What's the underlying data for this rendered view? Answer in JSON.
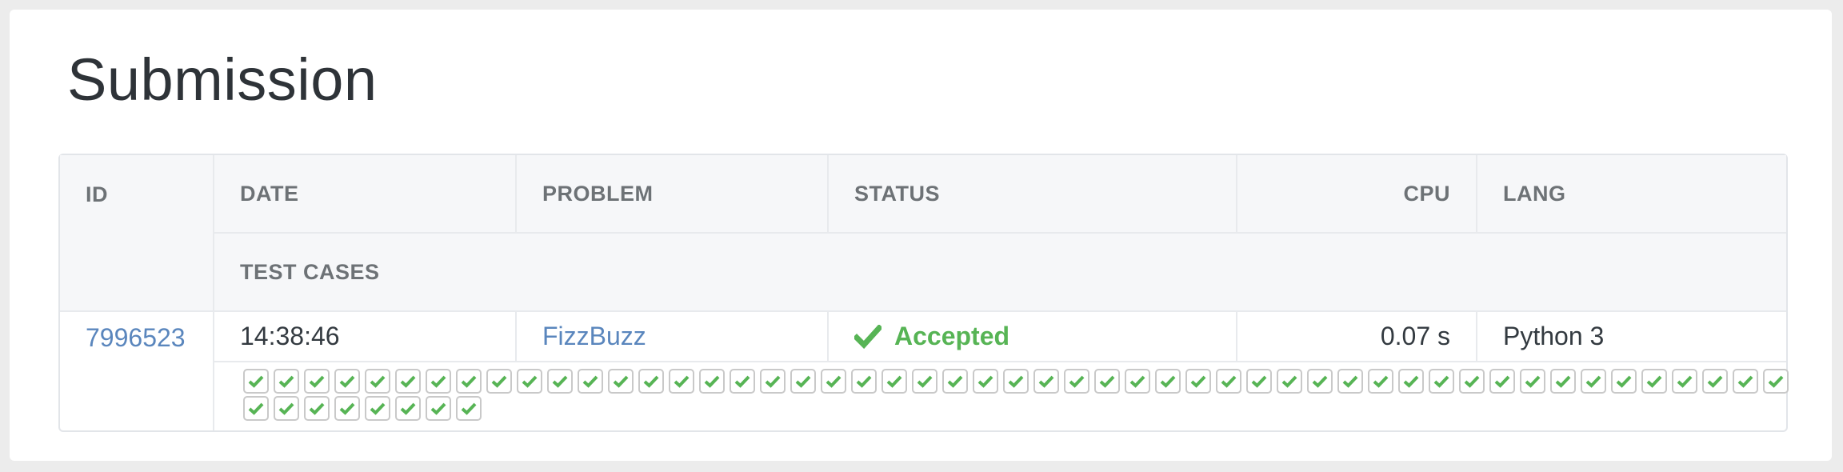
{
  "page": {
    "title": "Submission"
  },
  "table": {
    "headers": {
      "id": "ID",
      "date": "DATE",
      "problem": "PROBLEM",
      "status": "STATUS",
      "cpu": "CPU",
      "lang": "LANG",
      "test_cases": "TEST CASES"
    },
    "row": {
      "id": "7996523",
      "date": "14:38:46",
      "problem": "FizzBuzz",
      "status": "Accepted",
      "cpu": "0.07 s",
      "lang": "Python 3"
    },
    "test_cases": {
      "total": 59,
      "passed": 59,
      "icon": "check-icon"
    }
  },
  "colors": {
    "accepted": "#57b455",
    "link": "#5a86bd",
    "header_bg": "#f6f7f9"
  }
}
